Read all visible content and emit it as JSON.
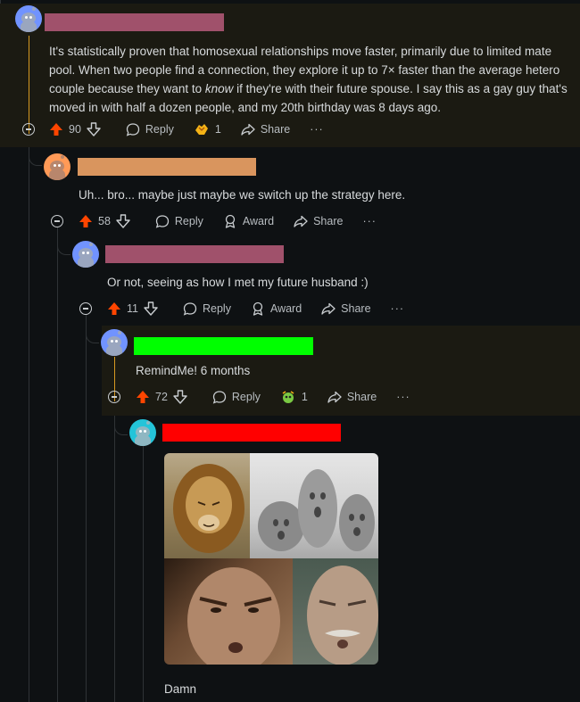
{
  "comments": [
    {
      "text_html": "It's statistically proven that homosexual relationships move faster, primarily due to limited mate pool. When two people find a connection, they explore it up to 7× faster than the average hetero couple because they want to ",
      "text_em": "know",
      "text_tail": " if they're with their future spouse. I say this as a gay guy that's moved in with half a dozen people, and my 20th birthday was 8 days ago.",
      "score": "90",
      "reply": "Reply",
      "award_count": "1",
      "share": "Share",
      "more": "···",
      "colors": {
        "name_bar": "#a0516b",
        "avatar": "#7193ff"
      }
    },
    {
      "text": "Uh... bro... maybe just maybe we switch up the strategy here.",
      "score": "58",
      "reply": "Reply",
      "award": "Award",
      "share": "Share",
      "more": "···",
      "colors": {
        "name_bar": "#d9955e",
        "avatar": "#ff9a57"
      }
    },
    {
      "text": "Or not, seeing as how I met my future husband :)",
      "score": "11",
      "reply": "Reply",
      "award": "Award",
      "share": "Share",
      "more": "···",
      "colors": {
        "name_bar": "#a0516b",
        "avatar": "#7193ff"
      }
    },
    {
      "text": "RemindMe! 6 months",
      "score": "72",
      "reply": "Reply",
      "award_count": "1",
      "share": "Share",
      "more": "···",
      "colors": {
        "name_bar": "#00ff00",
        "avatar": "#7193ff"
      }
    },
    {
      "text": "Damn",
      "image": "lion-and-rocks-meme",
      "colors": {
        "name_bar": "#ff0000",
        "avatar": "#24c4d9"
      }
    }
  ],
  "icons": [
    "upvote-icon",
    "downvote-icon",
    "reply-icon",
    "award-icon",
    "share-icon",
    "collapse-icon"
  ],
  "colors": {
    "background": "#0e1113",
    "upvote": "#ff4500",
    "highlight": "#1b1a12",
    "highlight_bar": "#d79921"
  }
}
